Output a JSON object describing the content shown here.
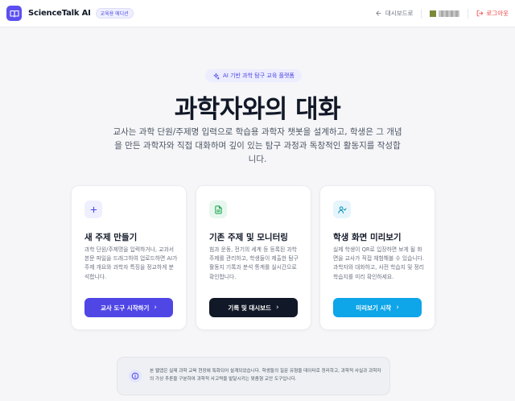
{
  "header": {
    "brand": "ScienceTalk AI",
    "edition_badge": "교육용 에디션",
    "dashboard_link": "대시보드로",
    "logout_link": "로그아웃"
  },
  "hero": {
    "badge": "AI 기반 과학 탐구 교육 플랫폼",
    "title": "과학자와의 대화",
    "description": "교사는 과학 단원/주제명 입력으로 학습용 과학자 챗봇을 설계하고, 학생은 그 개념을 만든 과학자와 직접 대화하며 깊이 있는 탐구 과정과 독창적인 활동지를 작성합니다."
  },
  "cards": [
    {
      "title": "새 주제 만들기",
      "description": "과학 단원/주제명을 입력하거나, 교과서 본문 파일을 드래그하여 업로드하면 AI가 주제 개요와 과학자 특징을 정교하게 분석합니다.",
      "button": "교사 도구 시작하기",
      "icon": "plus-icon",
      "accent": "#4f46e5"
    },
    {
      "title": "기존 주제 및 모니터링",
      "description": "힘과 운동, 전기의 세계 등 등록된 과학 주제를 관리하고, 학생들이 제출한 탐구 활동지 기록과 분석 통계를 실시간으로 확인합니다.",
      "button": "기록 및 대시보드",
      "icon": "document-icon",
      "accent": "#111827"
    },
    {
      "title": "학생 화면 미리보기",
      "description": "실제 학생이 QR로 입장하면 보게 될 화면을 교사가 직접 체험해볼 수 있습니다. 과학자와 대화하고, 사전 학습지 및 정리 학습지를 미리 확인하세요.",
      "button": "미리보기 시작",
      "icon": "user-icon",
      "accent": "#0ea5e9"
    }
  ],
  "info": {
    "text": "본 웹앱은 실제 과학 교육 현장에 특화되어 설계되었습니다. 학생들의 질문 유형을 데이터로 정리하고, 과학적 사실과 과학자의 가상 추론을 구분하여 과학적 사고력을 발달시키는 맞춤형 교안 도구입니다."
  }
}
